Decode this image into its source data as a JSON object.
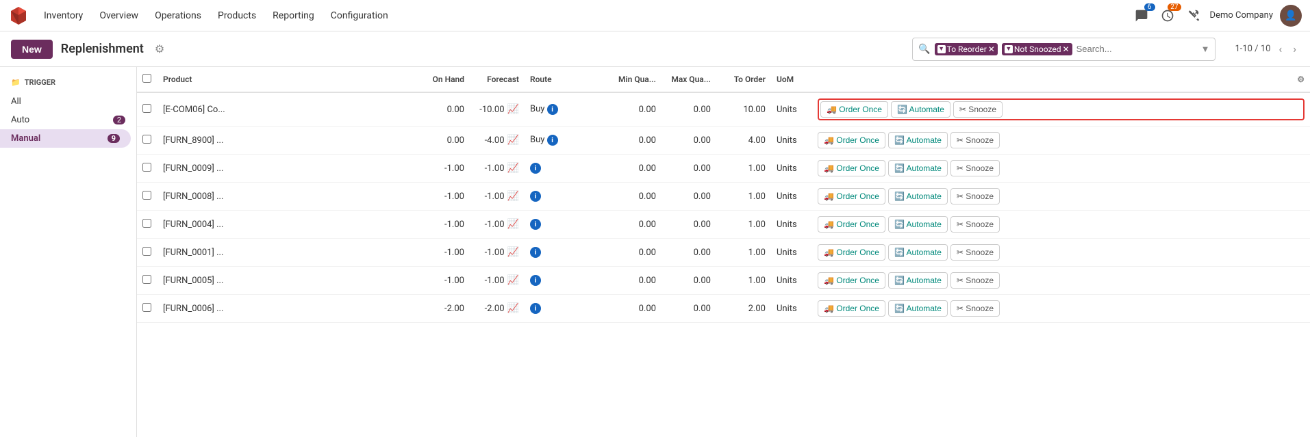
{
  "app": {
    "name": "Inventory"
  },
  "nav": {
    "items": [
      "Overview",
      "Operations",
      "Products",
      "Reporting",
      "Configuration"
    ],
    "notifications_badge": "6",
    "clock_badge": "27",
    "company": "Demo Company"
  },
  "toolbar": {
    "new_label": "New",
    "title": "Replenishment",
    "pagination": "1-10 / 10"
  },
  "search": {
    "placeholder": "Search...",
    "filters": [
      {
        "label": "To Reorder",
        "removable": true
      },
      {
        "label": "Not Snoozed",
        "removable": true
      }
    ]
  },
  "sidebar": {
    "section_title": "TRIGGER",
    "items": [
      {
        "label": "All",
        "count": null,
        "active": false
      },
      {
        "label": "Auto",
        "count": "2",
        "active": false
      },
      {
        "label": "Manual",
        "count": "9",
        "active": true
      }
    ]
  },
  "table": {
    "columns": [
      "Product",
      "On Hand",
      "Forecast",
      "Route",
      "Min Qua...",
      "Max Qua...",
      "To Order",
      "UoM"
    ],
    "rows": [
      {
        "id": 1,
        "product": "[E-COM06] Co...",
        "on_hand": "0.00",
        "forecast": "-10.00",
        "route": "Buy",
        "min_qty": "0.00",
        "max_qty": "0.00",
        "to_order": "10.00",
        "uom": "Units",
        "highlighted": true
      },
      {
        "id": 2,
        "product": "[FURN_8900] ...",
        "on_hand": "0.00",
        "forecast": "-4.00",
        "route": "Buy",
        "min_qty": "0.00",
        "max_qty": "0.00",
        "to_order": "4.00",
        "uom": "Units",
        "highlighted": false
      },
      {
        "id": 3,
        "product": "[FURN_0009] ...",
        "on_hand": "-1.00",
        "forecast": "-1.00",
        "route": "",
        "min_qty": "0.00",
        "max_qty": "0.00",
        "to_order": "1.00",
        "uom": "Units",
        "highlighted": false
      },
      {
        "id": 4,
        "product": "[FURN_0008] ...",
        "on_hand": "-1.00",
        "forecast": "-1.00",
        "route": "",
        "min_qty": "0.00",
        "max_qty": "0.00",
        "to_order": "1.00",
        "uom": "Units",
        "highlighted": false
      },
      {
        "id": 5,
        "product": "[FURN_0004] ...",
        "on_hand": "-1.00",
        "forecast": "-1.00",
        "route": "",
        "min_qty": "0.00",
        "max_qty": "0.00",
        "to_order": "1.00",
        "uom": "Units",
        "highlighted": false
      },
      {
        "id": 6,
        "product": "[FURN_0001] ...",
        "on_hand": "-1.00",
        "forecast": "-1.00",
        "route": "",
        "min_qty": "0.00",
        "max_qty": "0.00",
        "to_order": "1.00",
        "uom": "Units",
        "highlighted": false
      },
      {
        "id": 7,
        "product": "[FURN_0005] ...",
        "on_hand": "-1.00",
        "forecast": "-1.00",
        "route": "",
        "min_qty": "0.00",
        "max_qty": "0.00",
        "to_order": "1.00",
        "uom": "Units",
        "highlighted": false
      },
      {
        "id": 8,
        "product": "[FURN_0006] ...",
        "on_hand": "-2.00",
        "forecast": "-2.00",
        "route": "",
        "min_qty": "0.00",
        "max_qty": "0.00",
        "to_order": "2.00",
        "uom": "Units",
        "highlighted": false
      }
    ],
    "actions": {
      "order_once": "Order Once",
      "automate": "Automate",
      "snooze": "Snooze"
    }
  }
}
